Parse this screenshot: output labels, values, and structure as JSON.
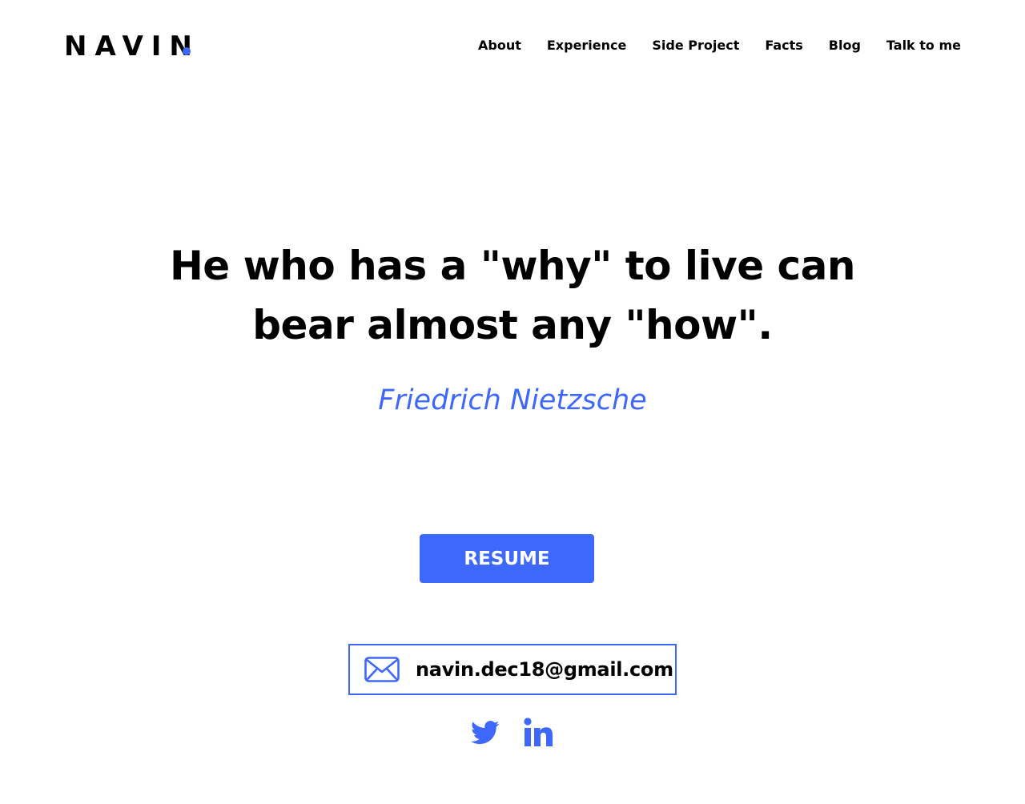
{
  "header": {
    "logo_text": "NAVIN",
    "nav": [
      {
        "label": "About"
      },
      {
        "label": "Experience"
      },
      {
        "label": "Side Project"
      },
      {
        "label": "Facts"
      },
      {
        "label": "Blog"
      },
      {
        "label": "Talk to me"
      }
    ]
  },
  "hero": {
    "quote": "He who has a \"why\" to live can bear almost any \"how\".",
    "author": "Friedrich Nietzsche",
    "resume_label": "RESUME"
  },
  "contact": {
    "email": "navin.dec18@gmail.com",
    "email_icon": "envelope-icon"
  },
  "social": [
    {
      "icon": "twitter-icon"
    },
    {
      "icon": "linkedin-icon"
    }
  ],
  "colors": {
    "accent": "#3e67fc",
    "text": "#000000",
    "background": "#ffffff"
  }
}
